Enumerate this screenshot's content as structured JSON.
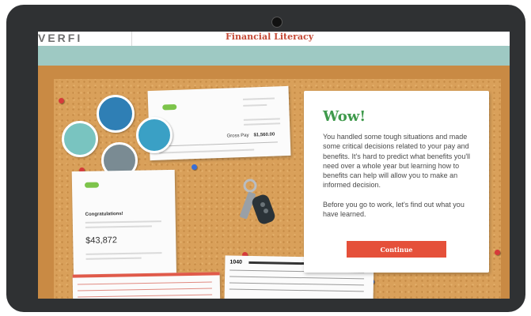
{
  "header": {
    "logo": "VERFI",
    "course_title": "Financial Literacy"
  },
  "board": {
    "paystub": {
      "gross_pay_label": "Gross Pay",
      "gross_pay_value": "$1,560.00"
    },
    "offer_letter": {
      "greeting": "Congratulations!",
      "salary": "$43,872"
    },
    "tax_form": {
      "label": "1040"
    }
  },
  "modal": {
    "title": "Wow!",
    "paragraph1": "You handled some tough situations and made some critical decisions related to your pay and benefits. It's hard to predict what benefits you'll need over a whole year but learning how to benefits can help will allow you to make an informed decision.",
    "paragraph2": "Before you go to work, let's find out what you have learned.",
    "button_label": "Continue"
  },
  "colors": {
    "accent_green": "#3f9a4c",
    "button_red": "#e5503a",
    "teal": "#9ec9c3",
    "cork": "#d9a05a",
    "tablet_bezel": "#2f3133"
  }
}
